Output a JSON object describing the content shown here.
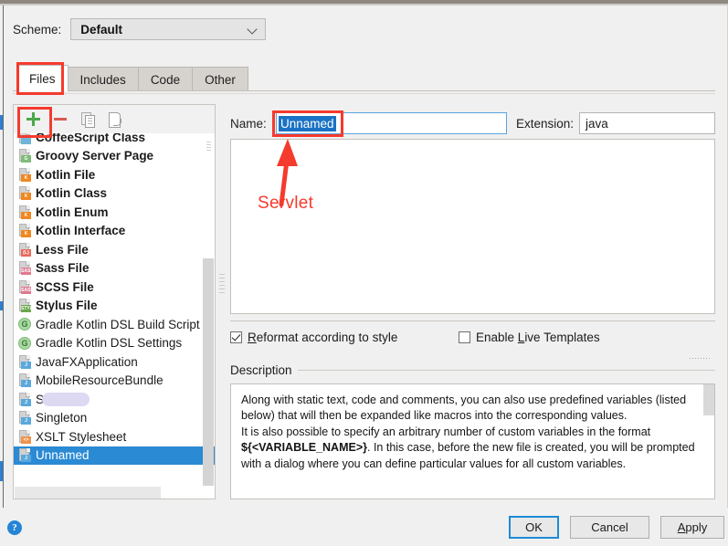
{
  "window": {
    "scheme": {
      "label": "Scheme:",
      "value": "Default",
      "chevron_icon": "chevron-down-icon"
    }
  },
  "tabs": [
    {
      "label": "Files",
      "active": true
    },
    {
      "label": "Includes",
      "active": false
    },
    {
      "label": "Code",
      "active": false
    },
    {
      "label": "Other",
      "active": false
    }
  ],
  "list_toolbar": {
    "add": {
      "icon": "plus-icon",
      "label": "+"
    },
    "remove": {
      "icon": "minus-icon",
      "label": "−"
    },
    "copy": {
      "icon": "copy-icon",
      "label": ""
    },
    "export": {
      "icon": "export-template-icon",
      "label": ""
    }
  },
  "template_list": {
    "items": [
      {
        "label": "CoffeeScript Class",
        "icon": "coffeescript-file-icon",
        "bold": true,
        "badge": "",
        "badge_color": "#6fb5d6",
        "selected": false,
        "clipped_top": true
      },
      {
        "label": "Groovy Server Page",
        "icon": "groovy-file-icon",
        "bold": true,
        "badge": "G",
        "badge_color": "#7fbb79",
        "selected": false
      },
      {
        "label": "Kotlin File",
        "icon": "kotlin-file-icon",
        "bold": true,
        "badge": "K",
        "badge_color": "#f0871f",
        "selected": false
      },
      {
        "label": "Kotlin Class",
        "icon": "kotlin-file-icon",
        "bold": true,
        "badge": "K",
        "badge_color": "#f0871f",
        "selected": false
      },
      {
        "label": "Kotlin Enum",
        "icon": "kotlin-file-icon",
        "bold": true,
        "badge": "K",
        "badge_color": "#f0871f",
        "selected": false
      },
      {
        "label": "Kotlin Interface",
        "icon": "kotlin-file-icon",
        "bold": true,
        "badge": "K",
        "badge_color": "#f0871f",
        "selected": false
      },
      {
        "label": "Less File",
        "icon": "less-file-icon",
        "bold": true,
        "badge": "{L}",
        "badge_color": "#e86a5c",
        "selected": false
      },
      {
        "label": "Sass File",
        "icon": "sass-file-icon",
        "bold": true,
        "badge": "SASS",
        "badge_color": "#e0788f",
        "selected": false
      },
      {
        "label": "SCSS File",
        "icon": "scss-file-icon",
        "bold": true,
        "badge": "SASS",
        "badge_color": "#e0788f",
        "selected": false
      },
      {
        "label": "Stylus File",
        "icon": "stylus-file-icon",
        "bold": true,
        "badge": "STYL",
        "badge_color": "#6aa84f",
        "selected": false
      },
      {
        "label": "Gradle Kotlin DSL Build Script",
        "icon": "gradle-circle-icon",
        "bold": false,
        "badge": "G",
        "badge_color": "#a9d8a2",
        "selected": false,
        "circle": true
      },
      {
        "label": "Gradle Kotlin DSL Settings",
        "icon": "gradle-circle-icon",
        "bold": false,
        "badge": "G",
        "badge_color": "#a9d8a2",
        "selected": false,
        "circle": true
      },
      {
        "label": "JavaFXApplication",
        "icon": "java-file-icon",
        "bold": false,
        "badge": "J",
        "badge_color": "#5aa9dd",
        "selected": false
      },
      {
        "label": "MobileResourceBundle",
        "icon": "java-file-icon",
        "bold": false,
        "badge": "J",
        "badge_color": "#5aa9dd",
        "selected": false
      },
      {
        "label": "S",
        "icon": "java-file-icon",
        "bold": false,
        "badge": "J",
        "badge_color": "#5aa9dd",
        "selected": false,
        "redacted": true
      },
      {
        "label": "Singleton",
        "icon": "java-file-icon",
        "bold": false,
        "badge": "J",
        "badge_color": "#5aa9dd",
        "selected": false
      },
      {
        "label": "XSLT Stylesheet",
        "icon": "xslt-file-icon",
        "bold": false,
        "badge": "<>",
        "badge_color": "#f0934a",
        "selected": false
      },
      {
        "label": "Unnamed",
        "icon": "java-file-icon",
        "bold": false,
        "badge": "J",
        "badge_color": "#5aa9dd",
        "selected": true
      }
    ]
  },
  "form": {
    "name_label": "Name:",
    "name_value": "Unnamed",
    "name_selected": true,
    "extension_label": "Extension:",
    "extension_value": "java",
    "editor_value": ""
  },
  "options": {
    "reformat": {
      "label_before": "R",
      "label_after": "eformat according to style",
      "checked": true
    },
    "live_templates": {
      "label_a": "Enable ",
      "label_b": "L",
      "label_c": "ive Templates",
      "checked": false
    }
  },
  "description": {
    "legend": "Description",
    "p1": "Along with static text, code and comments, you can also use predefined variables (listed below) that will then be expanded like macros into the corresponding values.",
    "p2_a": "It is also possible to specify an arbitrary number of custom variables in the format ",
    "p2_code": "${<VARIABLE_NAME>}",
    "p2_b": ". In this case, before the new file is created, you will be prompted with a dialog where you can define particular values for all custom variables."
  },
  "annotations": {
    "servlet_label": "Servlet",
    "highlight_color": "#f53a2e"
  },
  "footer": {
    "help_icon": "help-icon",
    "help_glyph": "?",
    "ok": "OK",
    "cancel": "Cancel",
    "apply_u": "A",
    "apply_rest": "pply"
  }
}
